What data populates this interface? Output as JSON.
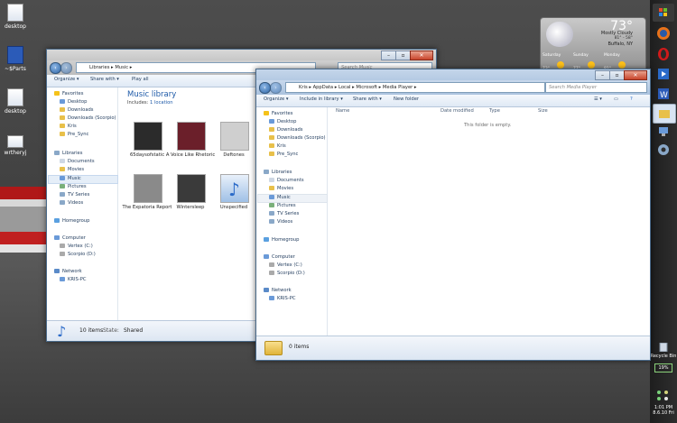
{
  "desktop": {
    "icons": [
      {
        "label": "desktop",
        "kind": "document"
      },
      {
        "label": "~$Parts",
        "kind": "word"
      },
      {
        "label": "desktop",
        "kind": "document"
      },
      {
        "label": "wrtheryj",
        "kind": "document"
      }
    ]
  },
  "weather": {
    "temp": "73°",
    "condition": "Mostly Cloudy",
    "hilo": "81° - 58°",
    "city": "Buffalo, NY",
    "forecast": [
      {
        "day": "Saturday",
        "temp": "73°"
      },
      {
        "day": "Sunday",
        "temp": "77°"
      },
      {
        "day": "Monday",
        "temp": "81°"
      }
    ]
  },
  "back_window": {
    "breadcrumb": [
      "Libraries",
      "Music"
    ],
    "search_placeholder": "Search Music",
    "commands": [
      "Organize ▾",
      "Share with ▾",
      "Play all"
    ],
    "library_title": "Music library",
    "includes_label": "Includes:",
    "includes_link": "1 location",
    "items": [
      {
        "label": "65daysofstatic",
        "color": "#2b2b2b"
      },
      {
        "label": "A Voice Like Rhetoric",
        "color": "#6b1f2a"
      },
      {
        "label": "Deftones",
        "color": "#cfcfcf"
      },
      {
        "label": "The Expatoria Report",
        "color": "#8a8a8a"
      },
      {
        "label": "Wintersleep",
        "color": "#3a3a3a"
      },
      {
        "label": "Unspecified",
        "color": "#4a86c8"
      }
    ],
    "status_count": "10 items",
    "status_state_label": "State:",
    "status_state": "Shared"
  },
  "front_window": {
    "breadcrumb": [
      "Kris",
      "AppData",
      "Local",
      "Microsoft",
      "Media Player"
    ],
    "search_placeholder": "Search Media Player",
    "commands": [
      "Organize ▾",
      "Include in library ▾",
      "Share with ▾",
      "New folder"
    ],
    "columns": [
      "Name",
      "Date modified",
      "Type",
      "Size"
    ],
    "empty_message": "This folder is empty.",
    "status_count": "0 items"
  },
  "nav_pane": {
    "favorites_header": "Favorites",
    "favorites": [
      "Desktop",
      "Downloads",
      "Downloads (Scorpio)",
      "Kris",
      "Pre_Sync"
    ],
    "libraries_header": "Libraries",
    "libraries": [
      "Documents",
      "Movies",
      "Music",
      "Pictures",
      "TV Series",
      "Videos"
    ],
    "homegroup": "Homegroup",
    "computer_header": "Computer",
    "drives": [
      "Vertex (C:)",
      "Scorpio (D:)"
    ],
    "network_header": "Network",
    "network_items": [
      "KRIS-PC"
    ]
  },
  "taskbar": {
    "recycle_bin": "Recycle Bin",
    "battery": "19%",
    "time": "1:01 PM",
    "date": "8.6.10 Fri"
  },
  "colors": {
    "accent": "#2f67a8",
    "link": "#1e5aa8",
    "stripe_red": "#b01818"
  }
}
